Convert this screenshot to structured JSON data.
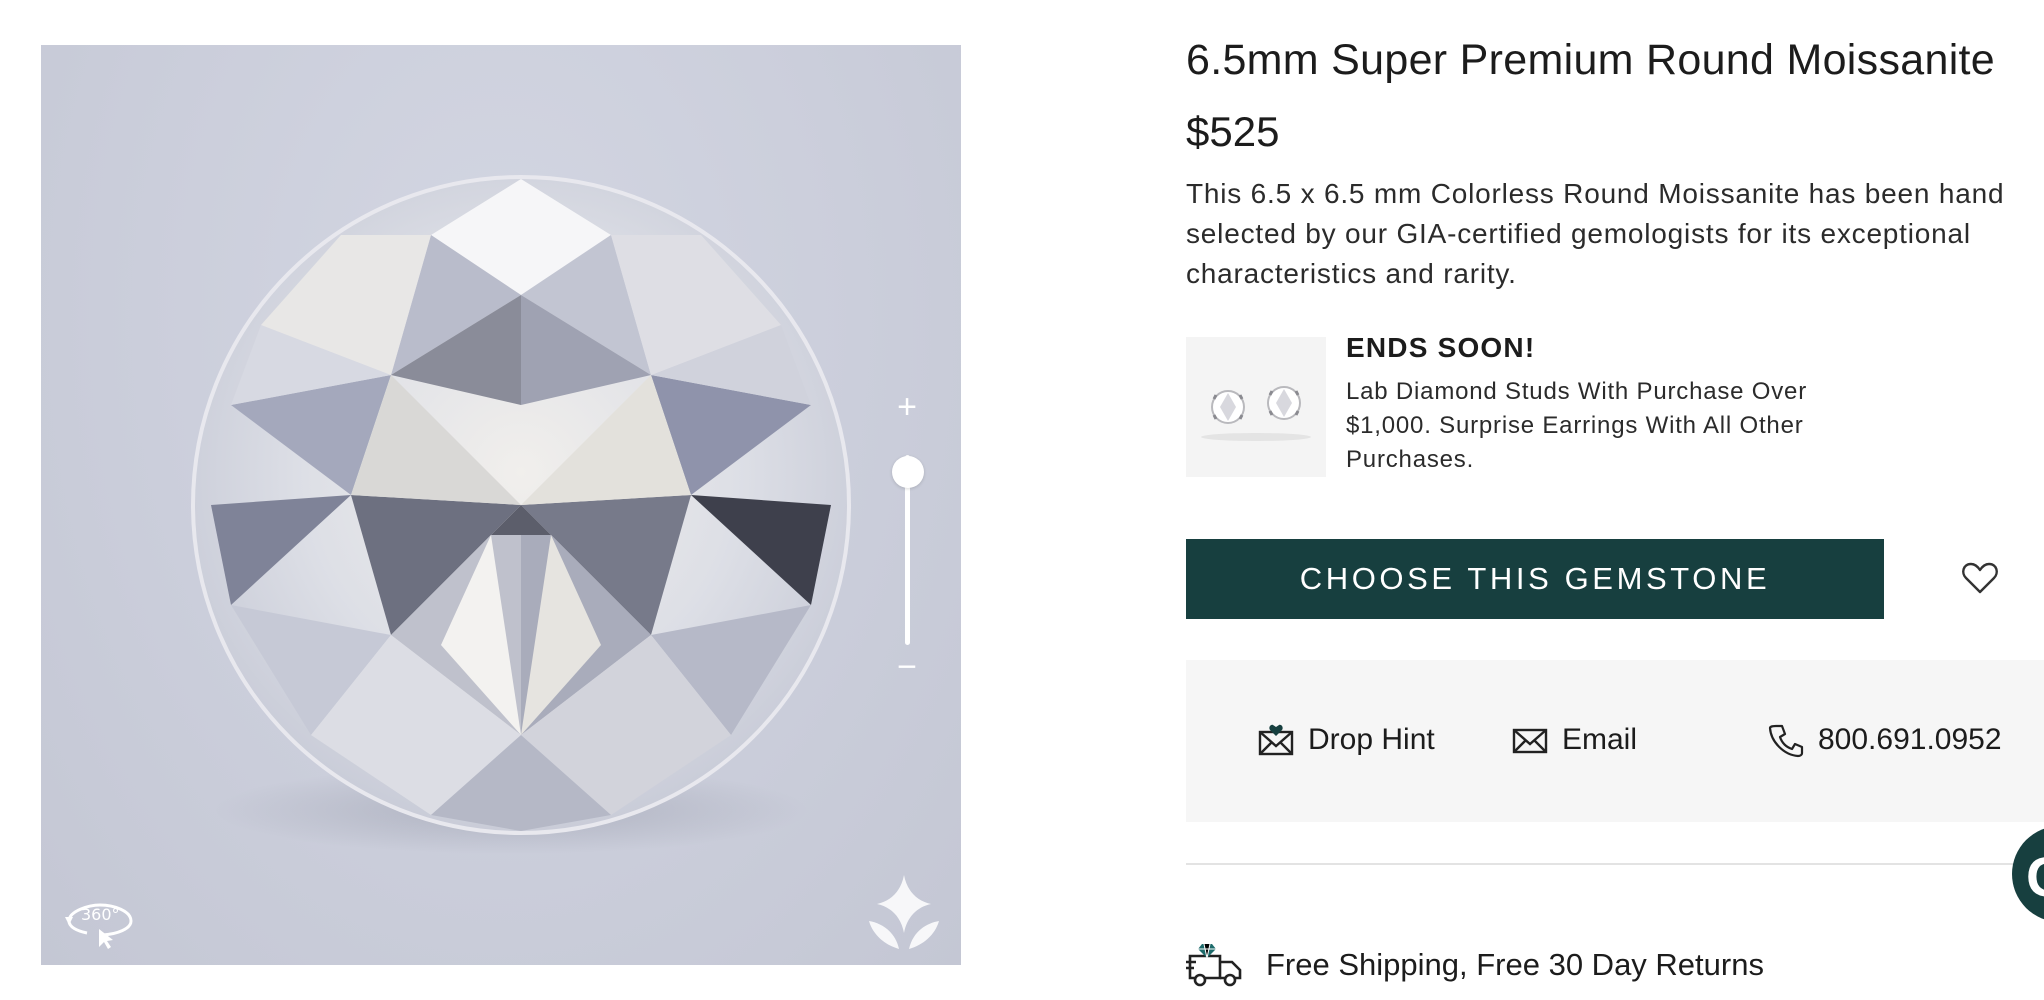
{
  "viewer": {
    "zoom_in_symbol": "+",
    "zoom_out_symbol": "−",
    "zoom_level": 0.9,
    "rotate_label": "360°",
    "icons": [
      "zoom-in-icon",
      "zoom-out-icon",
      "rotate-360-icon",
      "brand-mark-icon"
    ]
  },
  "product": {
    "title": "6.5mm Super Premium Round Moissanite",
    "price": "$525",
    "description": "This 6.5 x 6.5 mm Colorless Round Moissanite has been hand selected by our GIA-certified gemologists for its exceptional characteristics and rarity."
  },
  "promo": {
    "title": "ENDS SOON!",
    "text": "Lab Diamond Studs With Purchase Over $1,000. Surprise Earrings With All Other Purchases."
  },
  "actions": {
    "cta_label": "CHOOSE THIS GEMSTONE",
    "wishlist_icon": "heart-icon"
  },
  "contact": {
    "drop_hint": "Drop Hint",
    "email": "Email",
    "phone": "800.691.0952"
  },
  "shipping": {
    "label": "Free Shipping, Free 30 Day Returns",
    "icon": "delivery-truck-icon"
  },
  "chat": {
    "icon": "chat-icon",
    "glyph": "G"
  },
  "colors": {
    "brand_green": "#173f3f",
    "viewer_bg": "#cbcedb",
    "panel_bg": "#f6f6f6"
  }
}
